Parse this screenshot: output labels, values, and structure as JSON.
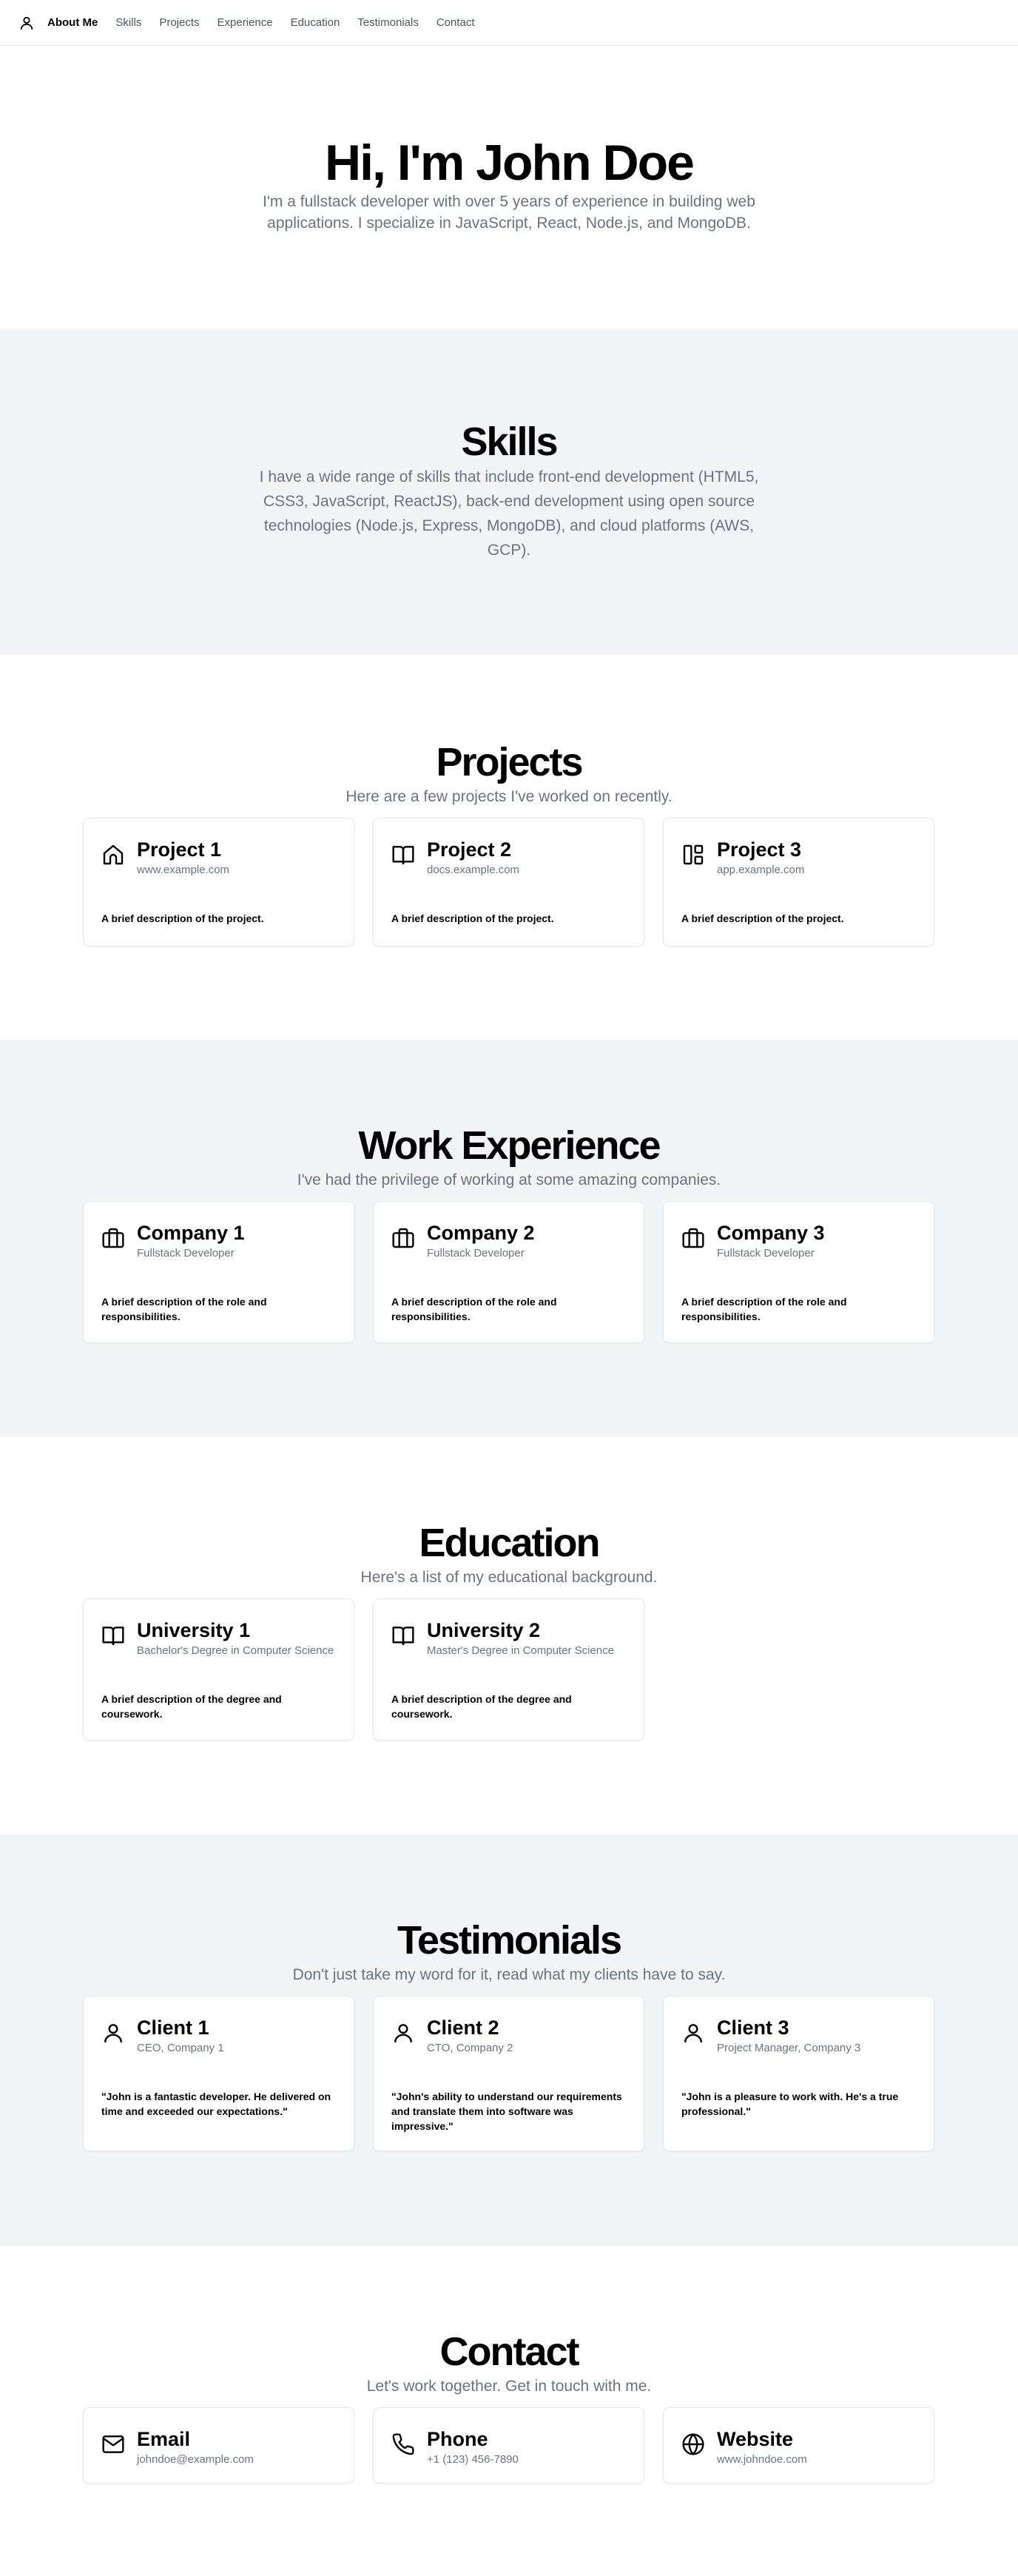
{
  "nav": {
    "items": [
      "About Me",
      "Skills",
      "Projects",
      "Experience",
      "Education",
      "Testimonials",
      "Contact"
    ]
  },
  "hero": {
    "title": "Hi, I'm John Doe",
    "description": "I'm a fullstack developer with over 5 years of experience in building web applications. I specialize in JavaScript, React, Node.js, and MongoDB."
  },
  "skills": {
    "title": "Skills",
    "description": "I have a wide range of skills that include front-end development (HTML5, CSS3, JavaScript, ReactJS), back-end development using open source technologies (Node.js, Express, MongoDB), and cloud platforms (AWS, GCP)."
  },
  "projects": {
    "title": "Projects",
    "subtitle": "Here are a few projects I've worked on recently.",
    "items": [
      {
        "icon": "home-icon",
        "title": "Project 1",
        "sub": "www.example.com",
        "body": "A brief description of the project."
      },
      {
        "icon": "book-open-icon",
        "title": "Project 2",
        "sub": "docs.example.com",
        "body": "A brief description of the project."
      },
      {
        "icon": "layout-icon",
        "title": "Project 3",
        "sub": "app.example.com",
        "body": "A brief description of the project."
      }
    ]
  },
  "experience": {
    "title": "Work Experience",
    "subtitle": "I've had the privilege of working at some amazing companies.",
    "items": [
      {
        "icon": "briefcase-icon",
        "title": "Company 1",
        "sub": "Fullstack Developer",
        "body": "A brief description of the role and responsibilities."
      },
      {
        "icon": "briefcase-icon",
        "title": "Company 2",
        "sub": "Fullstack Developer",
        "body": "A brief description of the role and responsibilities."
      },
      {
        "icon": "briefcase-icon",
        "title": "Company 3",
        "sub": "Fullstack Developer",
        "body": "A brief description of the role and responsibilities."
      }
    ]
  },
  "education": {
    "title": "Education",
    "subtitle": "Here's a list of my educational background.",
    "items": [
      {
        "icon": "book-open-icon",
        "title": "University 1",
        "sub": "Bachelor's Degree in Computer Science",
        "body": "A brief description of the degree and coursework."
      },
      {
        "icon": "book-open-icon",
        "title": "University 2",
        "sub": "Master's Degree in Computer Science",
        "body": "A brief description of the degree and coursework."
      }
    ]
  },
  "testimonials": {
    "title": "Testimonials",
    "subtitle": "Don't just take my word for it, read what my clients have to say.",
    "items": [
      {
        "icon": "user-icon",
        "title": "Client 1",
        "sub": "CEO, Company 1",
        "body": "\"John is a fantastic developer. He delivered on time and exceeded our expectations.\""
      },
      {
        "icon": "user-icon",
        "title": "Client 2",
        "sub": "CTO, Company 2",
        "body": "\"John's ability to understand our requirements and translate them into software was impressive.\""
      },
      {
        "icon": "user-icon",
        "title": "Client 3",
        "sub": "Project Manager, Company 3",
        "body": "\"John is a pleasure to work with. He's a true professional.\""
      }
    ]
  },
  "contact": {
    "title": "Contact",
    "subtitle": "Let's work together. Get in touch with me.",
    "items": [
      {
        "icon": "mail-icon",
        "title": "Email",
        "sub": "johndoe@example.com"
      },
      {
        "icon": "phone-icon",
        "title": "Phone",
        "sub": "+1 (123) 456-7890"
      },
      {
        "icon": "globe-icon",
        "title": "Website",
        "sub": "www.johndoe.com"
      }
    ]
  }
}
